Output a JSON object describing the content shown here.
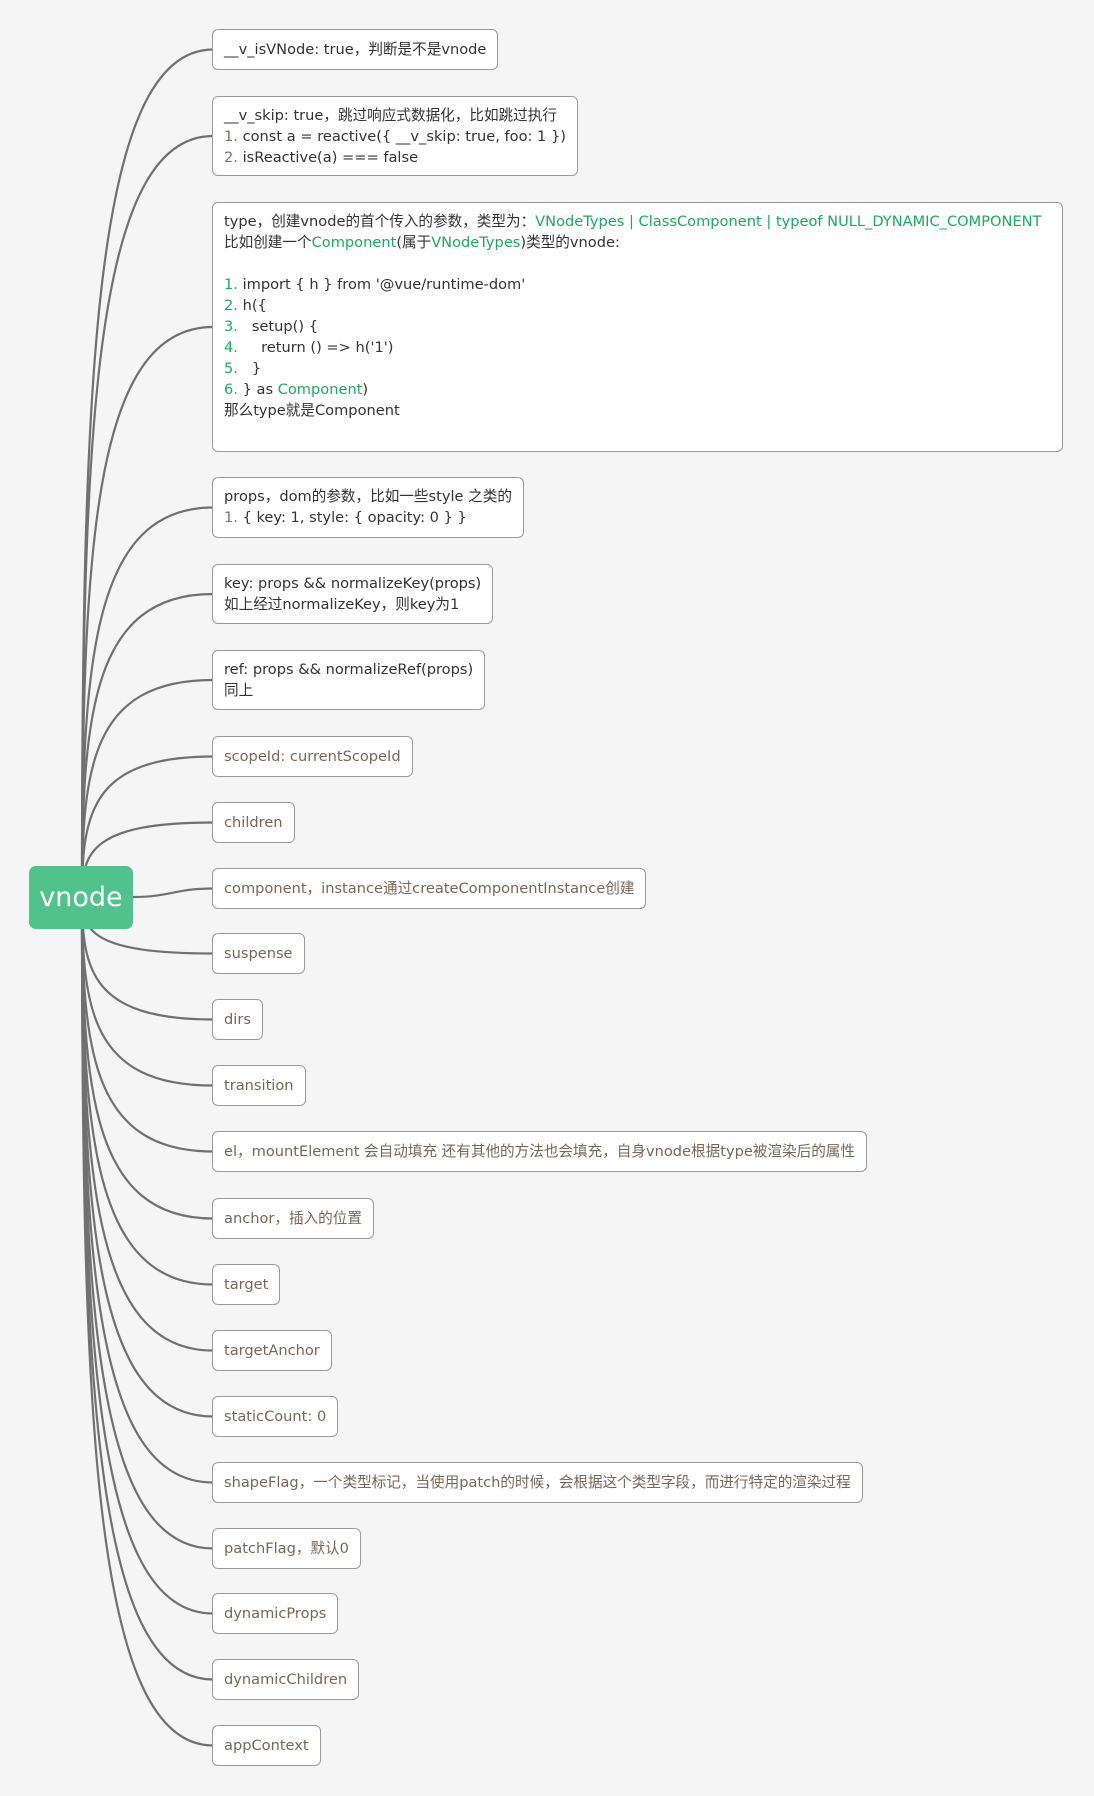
{
  "root": {
    "label": "vnode",
    "color": "#50c28c"
  },
  "colors": {
    "highlight": "#1aab5e",
    "single_text": "#7b6656",
    "multi_text": "#333333",
    "line": "#707070",
    "border": "#9a9a9a"
  },
  "nodes": {
    "isVNode": {
      "text": "__v_isVNode: true，判断是不是vnode"
    },
    "skip": {
      "title": "__v_skip: true，跳过响应式数据化，比如跳过执行",
      "items": [
        {
          "num": "1.",
          "text": "const a = reactive({ __v_skip: true, foo: 1 })"
        },
        {
          "num": "2.",
          "text": "isReactive(a) === false"
        }
      ]
    },
    "type": {
      "line1_prefix": "type，创建vnode的首个传入的参数，类型为：",
      "line1_types": "VNodeTypes | ClassComponent | typeof NULL_DYNAMIC_COMPONENT",
      "line2_a": "比如创建一个",
      "line2_b": "Component",
      "line2_c": "(属于",
      "line2_d": "VNodeTypes",
      "line2_e": ")类型的vnode:",
      "items": [
        {
          "num": "1.",
          "text": " import { h } from '@vue/runtime-dom'"
        },
        {
          "num": "2.",
          "text": " h({"
        },
        {
          "num": "3.",
          "text": "   setup() {"
        },
        {
          "num": "4.",
          "text": "     return () => h('1')"
        },
        {
          "num": "5.",
          "text": "   }"
        },
        {
          "num": "6.",
          "text": " } as ",
          "hl": "Component",
          "tail": ")"
        }
      ],
      "conclusion": "那么type就是Component"
    },
    "props": {
      "title": "props，dom的参数，比如一些style 之类的",
      "items": [
        {
          "num": "1.",
          "text": " { key: 1, style: { opacity: 0 } }"
        }
      ]
    },
    "key": {
      "line1": "key: props && normalizeKey(props)",
      "line2": "如上经过normalizeKey，则key为1"
    },
    "ref": {
      "line1": "ref: props && normalizeRef(props)",
      "line2": "同上"
    },
    "simple": [
      {
        "id": "scopeId",
        "text": "scopeId: currentScopeId"
      },
      {
        "id": "children",
        "text": "children"
      },
      {
        "id": "component",
        "text": "component，instance通过createComponentInstance创建"
      },
      {
        "id": "suspense",
        "text": "suspense"
      },
      {
        "id": "dirs",
        "text": "dirs"
      },
      {
        "id": "transition",
        "text": "transition"
      },
      {
        "id": "el",
        "text": "el，mountElement 会自动填充 还有其他的方法也会填充，自身vnode根据type被渲染后的属性"
      },
      {
        "id": "anchor",
        "text": "anchor，插入的位置"
      },
      {
        "id": "target",
        "text": "target"
      },
      {
        "id": "targetAnchor",
        "text": "targetAnchor"
      },
      {
        "id": "staticCount",
        "text": "staticCount: 0"
      },
      {
        "id": "shapeFlag",
        "text": "shapeFlag，一个类型标记，当使用patch的时候，会根据这个类型字段，而进行特定的渲染过程"
      },
      {
        "id": "patchFlag",
        "text": "patchFlag，默认0"
      },
      {
        "id": "dynamicProps",
        "text": "dynamicProps"
      },
      {
        "id": "dynamicChildren",
        "text": "dynamicChildren"
      },
      {
        "id": "appContext",
        "text": "appContext"
      }
    ]
  }
}
